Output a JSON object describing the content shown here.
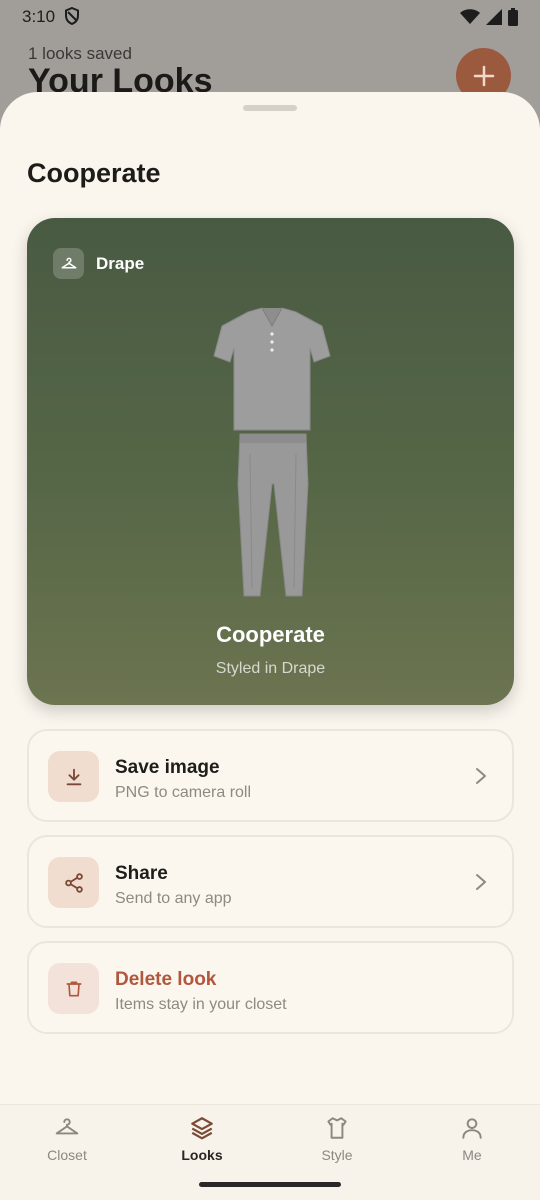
{
  "status": {
    "time": "3:10"
  },
  "background": {
    "subtitle": "1 looks saved",
    "title": "Your Looks"
  },
  "sheet": {
    "title": "Cooperate",
    "preview": {
      "brand": "Drape",
      "look_name": "Cooperate",
      "look_sub": "Styled in Drape"
    },
    "actions": [
      {
        "title": "Save image",
        "subtitle": "PNG to camera roll",
        "icon": "download-icon"
      },
      {
        "title": "Share",
        "subtitle": "Send to any app",
        "icon": "share-icon"
      },
      {
        "title": "Delete look",
        "subtitle": "Items stay in your closet",
        "icon": "trash-icon"
      }
    ]
  },
  "nav": {
    "items": [
      {
        "label": "Closet",
        "icon": "hanger-icon"
      },
      {
        "label": "Looks",
        "icon": "layers-icon",
        "active": true
      },
      {
        "label": "Style",
        "icon": "shirt-icon"
      },
      {
        "label": "Me",
        "icon": "person-icon"
      }
    ]
  },
  "colors": {
    "accent": "#9b5a3d",
    "danger": "#b1573d",
    "card_green": "#566747",
    "sheet_bg": "#faf6ee"
  }
}
